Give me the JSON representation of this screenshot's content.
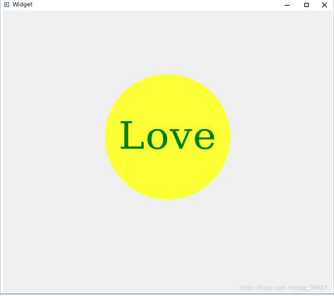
{
  "window": {
    "title": "Widget",
    "controls": {
      "minimize": "minimize",
      "maximize": "maximize",
      "close": "close"
    }
  },
  "canvas": {
    "background_color": "#efefef",
    "circle_color": "#fbff36",
    "text": "Love",
    "text_color": "#008000"
  },
  "watermark": "https://blog.csdn.net/qq_39687"
}
